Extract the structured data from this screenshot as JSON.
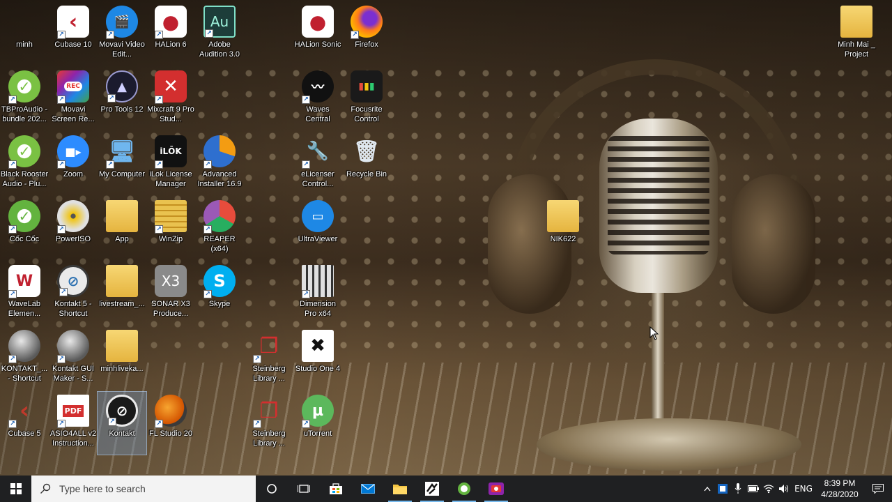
{
  "desktop": {
    "icons": [
      {
        "label": "minh"
      },
      {
        "label": "Cubase 10"
      },
      {
        "label": "Movavi Video Edit..."
      },
      {
        "label": "HALion 6"
      },
      {
        "label": "Adobe Audition 3.0"
      },
      {
        "label": "HALion Sonic"
      },
      {
        "label": "Firefox"
      },
      {
        "label": "Minh Mai _ Project"
      },
      {
        "label": "TBProAudio - bundle 202..."
      },
      {
        "label": "Movavi Screen Re..."
      },
      {
        "label": "Pro Tools 12"
      },
      {
        "label": "Mixcraft 9 Pro Stud..."
      },
      {
        "label": "Waves Central"
      },
      {
        "label": "Focusrite Control"
      },
      {
        "label": "Black Rooster Audio - Plu..."
      },
      {
        "label": "Zoom"
      },
      {
        "label": "My Computer"
      },
      {
        "label": "iLok License Manager"
      },
      {
        "label": "Advanced Installer 16.9"
      },
      {
        "label": "eLicenser Control..."
      },
      {
        "label": "Recycle Bin"
      },
      {
        "label": "Cốc Cốc"
      },
      {
        "label": "PowerISO"
      },
      {
        "label": "App"
      },
      {
        "label": "WinZip"
      },
      {
        "label": "REAPER (x64)"
      },
      {
        "label": "UltraViewer"
      },
      {
        "label": "NIK622"
      },
      {
        "label": "WaveLab Elemen..."
      },
      {
        "label": "Kontakt 5 - Shortcut"
      },
      {
        "label": "livestream_..."
      },
      {
        "label": "SONAR X3 Produce..."
      },
      {
        "label": "Skype"
      },
      {
        "label": "Dimension Pro x64"
      },
      {
        "label": "KONTAKT_... - Shortcut"
      },
      {
        "label": "Kontakt GUI Maker - S..."
      },
      {
        "label": "minhliveka..."
      },
      {
        "label": "Steinberg Library ..."
      },
      {
        "label": "Studio One 4"
      },
      {
        "label": "Cubase 5"
      },
      {
        "label": "ASIO4ALL v2 Instruction..."
      },
      {
        "label": "Kontakt"
      },
      {
        "label": "FL Studio 20"
      },
      {
        "label": "Steinberg Library ..."
      },
      {
        "label": "uTorrent"
      }
    ],
    "icon_glyphs": {
      "adobe_audition": "Au",
      "sonar": "X3",
      "ilok": "iLŌK",
      "skype": "S",
      "movavi_rec": "REC",
      "pdf": "PDF"
    }
  },
  "taskbar": {
    "search_placeholder": "Type here to search",
    "language": "ENG",
    "time": "8:39 PM",
    "date": "4/28/2020",
    "accent_color": "#76b9ed"
  }
}
